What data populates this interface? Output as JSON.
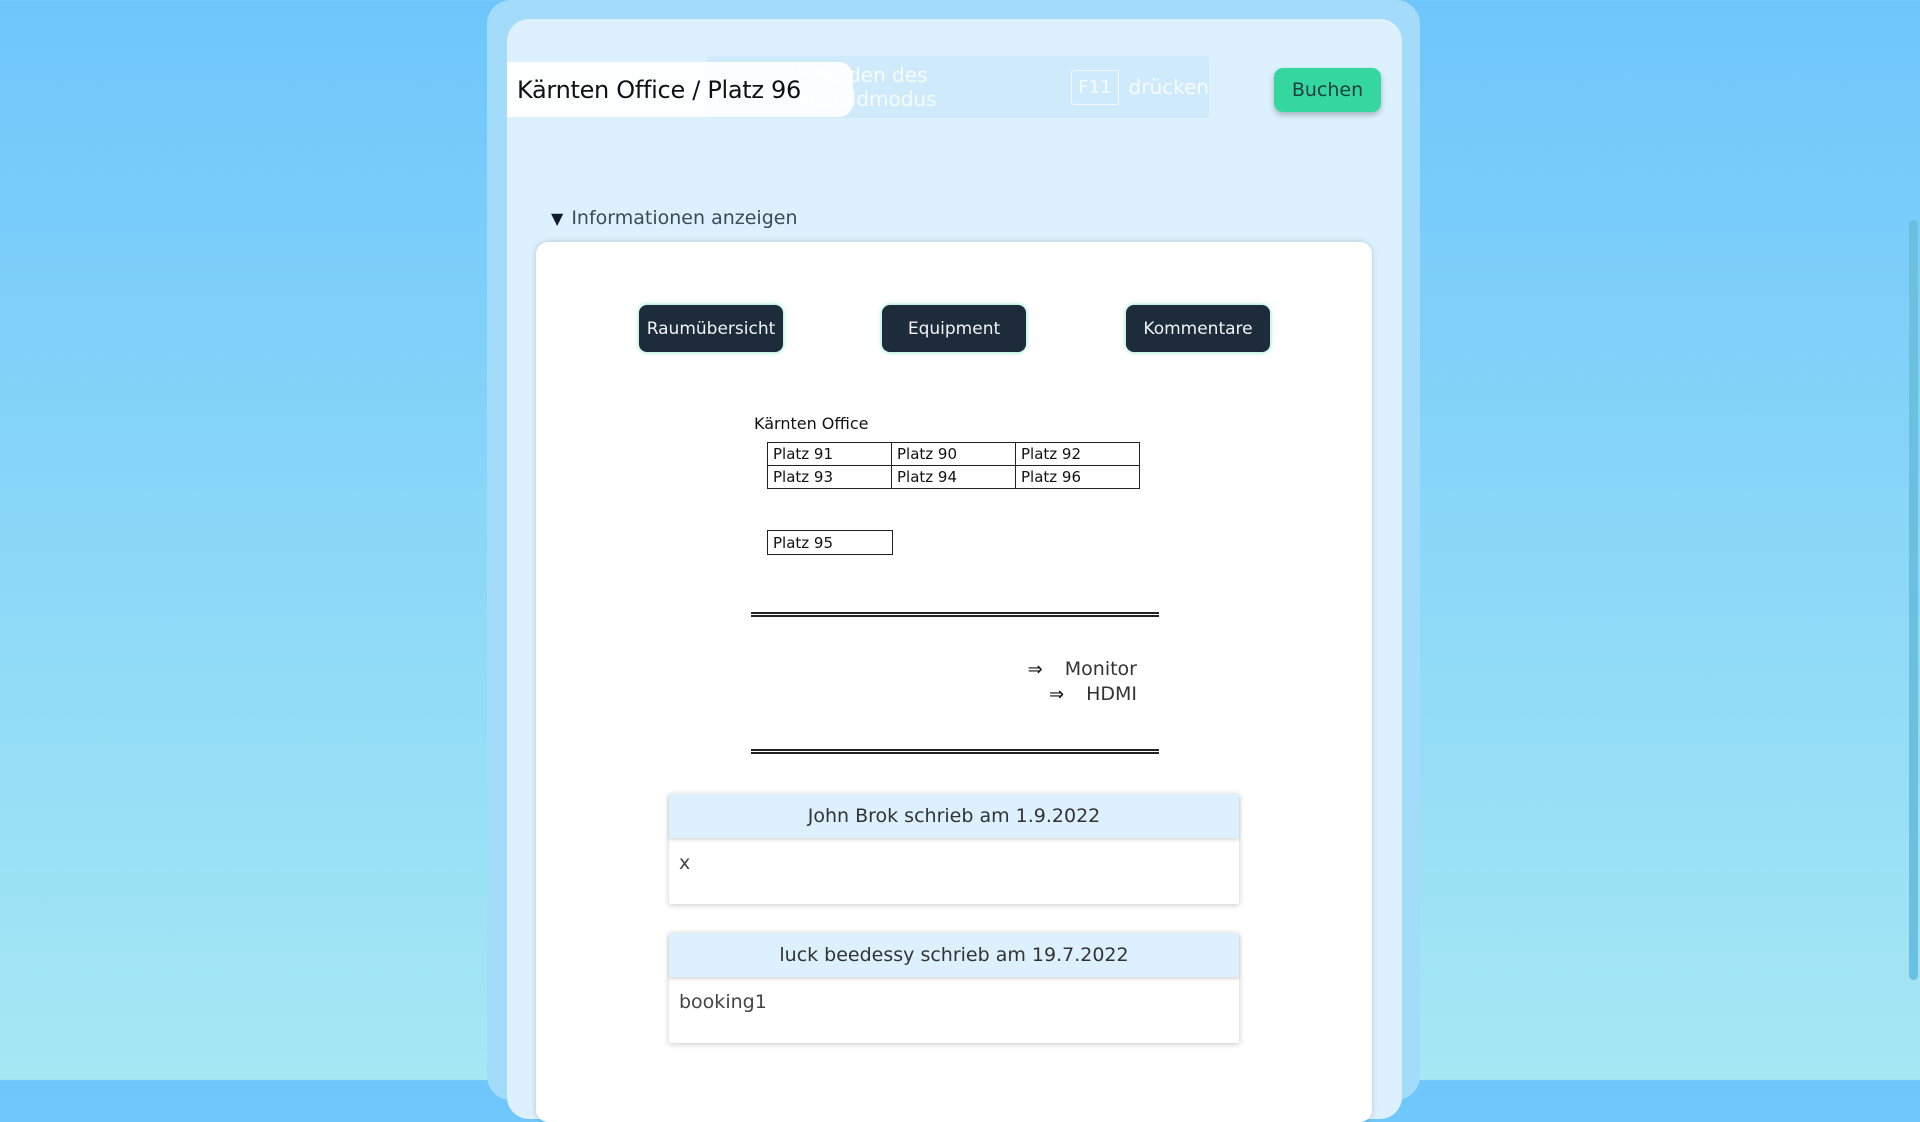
{
  "header": {
    "title": "Kärnten Office / Platz 96",
    "book_label": "Buchen",
    "fullscreen_hint": {
      "prefix": "Beenden des Vollbildmodus",
      "key": "F11",
      "suffix": "drücken"
    }
  },
  "info_toggle": {
    "label": "Informationen anzeigen"
  },
  "tabs": {
    "room_overview": "Raumübersicht",
    "equipment": "Equipment",
    "comments": "Kommentare"
  },
  "room_overview": {
    "office_name": "Kärnten Office",
    "grid": [
      [
        "Platz 91",
        "Platz 90",
        "Platz 92"
      ],
      [
        "Platz 93",
        "Platz 94",
        "Platz 96"
      ]
    ],
    "single_seat": "Platz 95"
  },
  "equipment": {
    "arrow": "⇒",
    "items": [
      "Monitor",
      "HDMI"
    ]
  },
  "comments": [
    {
      "header": "John Brok schrieb am 1.9.2022",
      "text": "x"
    },
    {
      "header": "luck beedessy schrieb am 19.7.2022",
      "text": "booking1"
    }
  ]
}
